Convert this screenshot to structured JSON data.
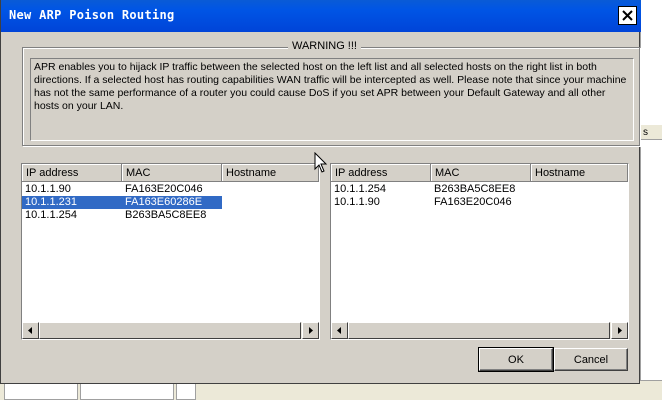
{
  "window": {
    "title": "New ARP Poison Routing"
  },
  "warning": {
    "title": "WARNING !!!",
    "text": "APR enables you to hijack IP traffic between the selected host on the left list and all selected hosts on the right list in both directions. If a selected host has routing capabilities WAN traffic will be intercepted as well. Please note that since your machine has not the same performance of a router you could cause DoS if you set APR between your Default Gateway and all other hosts on your LAN."
  },
  "left_list": {
    "columns": [
      "IP address",
      "MAC",
      "Hostname"
    ],
    "rows": [
      {
        "ip": "10.1.1.90",
        "mac": "FA163E20C046",
        "hostname": ""
      },
      {
        "ip": "10.1.1.231",
        "mac": "FA163E60286E",
        "hostname": "",
        "selected": true
      },
      {
        "ip": "10.1.1.254",
        "mac": "B263BA5C8EE8",
        "hostname": ""
      }
    ]
  },
  "right_list": {
    "columns": [
      "IP address",
      "MAC",
      "Hostname"
    ],
    "rows": [
      {
        "ip": "10.1.1.254",
        "mac": "B263BA5C8EE8",
        "hostname": ""
      },
      {
        "ip": "10.1.1.90",
        "mac": "FA163E20C046",
        "hostname": ""
      }
    ]
  },
  "buttons": {
    "ok": "OK",
    "cancel": "Cancel"
  },
  "background": {
    "right_header_text": "s"
  },
  "colors": {
    "titlebar": "#0055e5",
    "selection": "#316ac5",
    "dialog_bg": "#d4d0c8"
  },
  "icons": {
    "close": "close-icon",
    "scroll_left": "arrow-left-icon",
    "scroll_right": "arrow-right-icon",
    "cursor": "mouse-pointer-icon"
  }
}
